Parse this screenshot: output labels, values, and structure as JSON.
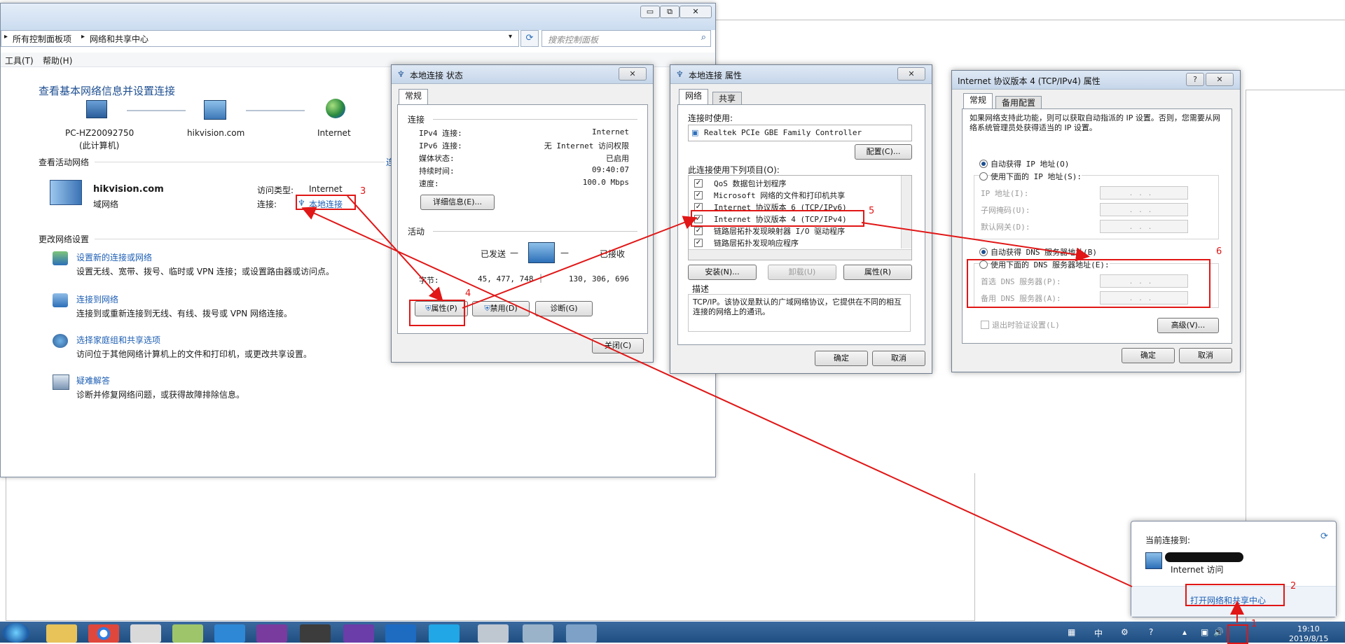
{
  "explorer": {
    "address": [
      "所有控制面板项",
      "网络和共享中心"
    ],
    "search_placeholder": "搜索控制面板",
    "menu": [
      "工具(T)",
      "帮助(H)"
    ],
    "heading": "查看基本网络信息并设置连接",
    "map_nodes": [
      {
        "name": "PC-HZ20092750",
        "sub": "(此计算机)"
      },
      {
        "name": "hikvision.com",
        "sub": ""
      },
      {
        "name": "Internet",
        "sub": ""
      }
    ],
    "active_networks_label": "查看活动网络",
    "network_name": "hikvision.com",
    "network_type": "域网络",
    "access_type_label": "访问类型:",
    "access_type_value": "Internet",
    "connection_label": "连接:",
    "connection_value": "本地连接",
    "change_settings_label": "更改网络设置",
    "tasks": [
      {
        "title": "设置新的连接或网络",
        "desc": "设置无线、宽带、拨号、临时或 VPN 连接；或设置路由器或访问点。"
      },
      {
        "title": "连接到网络",
        "desc": "连接到或重新连接到无线、有线、拨号或 VPN 网络连接。"
      },
      {
        "title": "选择家庭组和共享选项",
        "desc": "访问位于其他网络计算机上的文件和打印机，或更改共享设置。"
      },
      {
        "title": "疑难解答",
        "desc": "诊断并修复网络问题，或获得故障排除信息。"
      }
    ],
    "cut_text": "连"
  },
  "status_dialog": {
    "title": "本地连接 状态",
    "close": "✕",
    "tab": "常规",
    "connection_section": "连接",
    "rows": [
      {
        "label": "IPv4 连接:",
        "value": "Internet"
      },
      {
        "label": "IPv6 连接:",
        "value": "无 Internet 访问权限"
      },
      {
        "label": "媒体状态:",
        "value": "已启用"
      },
      {
        "label": "持续时间:",
        "value": "09:40:07"
      },
      {
        "label": "速度:",
        "value": "100.0 Mbps"
      }
    ],
    "details_btn": "详细信息(E)...",
    "activity_section": "活动",
    "sent_label": "已发送",
    "received_label": "已接收",
    "bytes_label": "字节:",
    "bytes_sent": "45, 477, 748",
    "bytes_received": "130, 306, 696",
    "properties_btn": "属性(P)",
    "disable_btn": "禁用(D)",
    "diagnose_btn": "诊断(G)",
    "close_btn": "关闭(C)"
  },
  "props_dialog": {
    "title": "本地连接 属性",
    "close": "✕",
    "tabs": [
      "网络",
      "共享"
    ],
    "connect_using_label": "连接时使用:",
    "adapter": "Realtek PCIe GBE Family Controller",
    "configure_btn": "配置(C)...",
    "items_label": "此连接使用下列项目(O):",
    "items": [
      "QoS 数据包计划程序",
      "Microsoft 网络的文件和打印机共享",
      "Internet 协议版本 6 (TCP/IPv6)",
      "Internet 协议版本 4 (TCP/IPv4)",
      "链路层拓扑发现映射器 I/O 驱动程序",
      "链路层拓扑发现响应程序"
    ],
    "install_btn": "安装(N)...",
    "uninstall_btn": "卸载(U)",
    "properties_btn": "属性(R)",
    "desc_label": "描述",
    "desc_text": "TCP/IP。该协议是默认的广域网络协议，它提供在不同的相互连接的网络上的通讯。",
    "ok_btn": "确定",
    "cancel_btn": "取消"
  },
  "ipv4_dialog": {
    "title": "Internet 协议版本 4 (TCP/IPv4) 属性",
    "help": "?",
    "close": "✕",
    "tabs": [
      "常规",
      "备用配置"
    ],
    "intro": "如果网络支持此功能，则可以获取自动指派的 IP 设置。否则，您需要从网络系统管理员处获得适当的 IP 设置。",
    "auto_ip": "自动获得 IP 地址(O)",
    "manual_ip": "使用下面的 IP 地址(S):",
    "ip_label": "IP 地址(I):",
    "mask_label": "子网掩码(U):",
    "gateway_label": "默认网关(D):",
    "auto_dns": "自动获得 DNS 服务器地址(B)",
    "manual_dns": "使用下面的 DNS 服务器地址(E):",
    "preferred_dns_label": "首选 DNS 服务器(P):",
    "alternate_dns_label": "备用 DNS 服务器(A):",
    "field_dots": "...",
    "validate_label": "退出时验证设置(L)",
    "advanced_btn": "高级(V)...",
    "ok_btn": "确定",
    "cancel_btn": "取消"
  },
  "popup": {
    "connected_to": "当前连接到:",
    "access": "Internet 访问",
    "open_center": "打开网络和共享中心"
  },
  "tray": {
    "ime": "中",
    "time": "19:10",
    "date": "2019/8/15"
  },
  "annotations": [
    "1",
    "2",
    "3",
    "4",
    "5",
    "6"
  ],
  "colors": {
    "annotation": "#e11616",
    "link": "#1e5fb4",
    "taskbar": "#1f4f82"
  }
}
